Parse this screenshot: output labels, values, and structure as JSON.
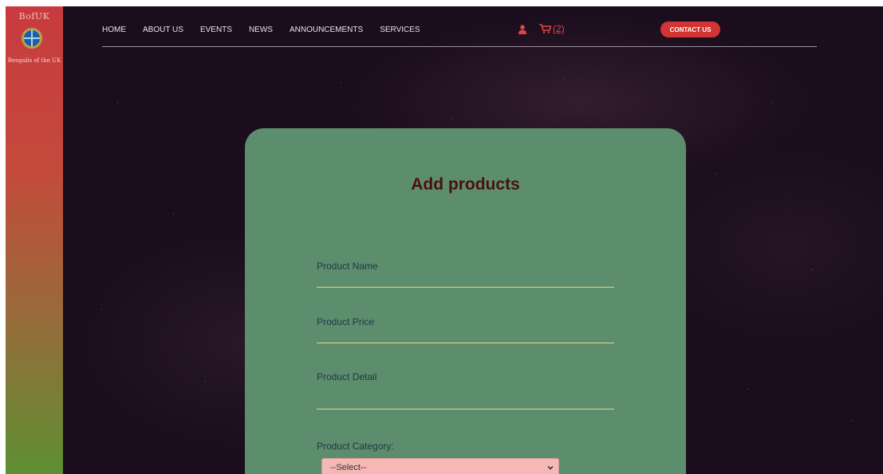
{
  "brand": {
    "logo_text": "BofUK",
    "logo_subtitle": "Bengalis of the UK"
  },
  "nav": {
    "items": [
      "HOME",
      "ABOUT US",
      "EVENTS",
      "NEWS",
      "ANNOUNCEMENTS",
      "SERVICES"
    ],
    "cart_count": "(2)",
    "contact_label": "CONTACT US"
  },
  "form": {
    "title": "Add products",
    "product_name_label": "Product Name",
    "product_price_label": "Product Price",
    "product_detail_label": "Product Detail",
    "product_category_label": "Product Category:",
    "category_selected": "--Select--"
  },
  "colors": {
    "accent": "#d23434",
    "card": "#5c8d6c",
    "title": "#4a1010"
  }
}
